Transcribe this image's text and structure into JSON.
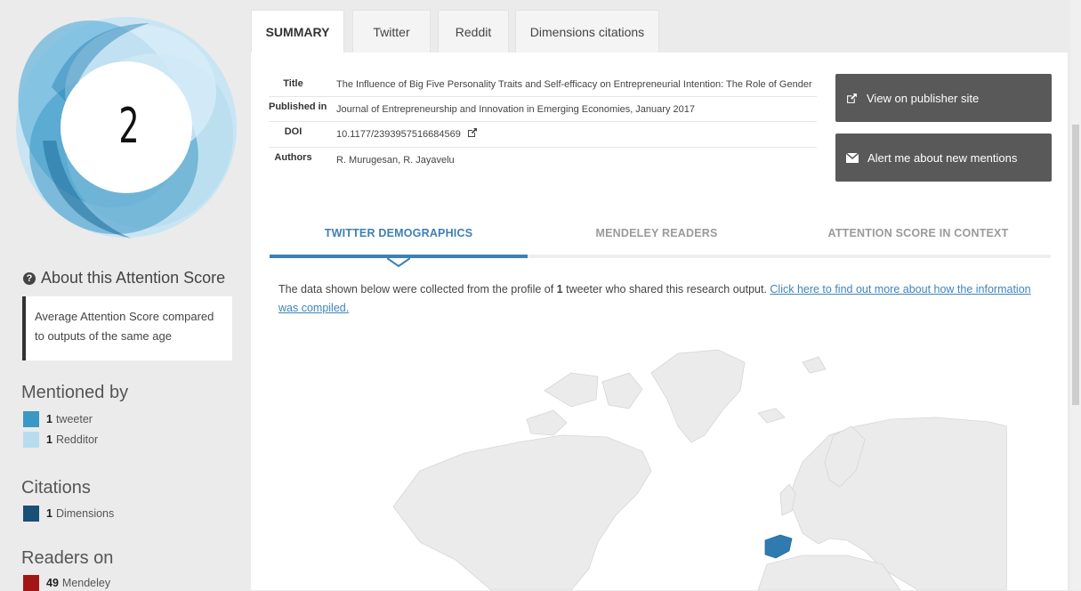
{
  "score": {
    "value": "2"
  },
  "about": {
    "heading": "About this Attention Score",
    "description": "Average Attention Score compared to outputs of the same age"
  },
  "mentioned_by": {
    "heading": "Mentioned by",
    "items": [
      {
        "count": "1",
        "label": "tweeter",
        "color": "#3a98c4"
      },
      {
        "count": "1",
        "label": "Redditor",
        "color": "#b8dcef"
      }
    ]
  },
  "citations": {
    "heading": "Citations",
    "items": [
      {
        "count": "1",
        "label": "Dimensions",
        "color": "#1a4f78"
      }
    ]
  },
  "readers": {
    "heading": "Readers on",
    "items": [
      {
        "count": "49",
        "label": "Mendeley",
        "color": "#a31616"
      }
    ]
  },
  "tabs": [
    {
      "label": "SUMMARY",
      "active": true
    },
    {
      "label": "Twitter",
      "active": false
    },
    {
      "label": "Reddit",
      "active": false
    },
    {
      "label": "Dimensions citations",
      "active": false
    }
  ],
  "metadata": {
    "title_label": "Title",
    "title_value": "The Influence of Big Five Personality Traits and Self-efficacy on Entrepreneurial Intention: The Role of Gender",
    "published_label": "Published in",
    "published_value": "Journal of Entrepreneurship and Innovation in Emerging Economies, January 2017",
    "doi_label": "DOI",
    "doi_value": "10.1177/2393957516684569",
    "authors_label": "Authors",
    "authors_value": "R. Murugesan, R. Jayavelu"
  },
  "buttons": {
    "publisher": "View on publisher site",
    "alert": "Alert me about new mentions"
  },
  "secondary_tabs": [
    {
      "label": "TWITTER DEMOGRAPHICS",
      "active": true
    },
    {
      "label": "MENDELEY READERS",
      "active": false
    },
    {
      "label": "ATTENTION SCORE IN CONTEXT",
      "active": false
    }
  ],
  "description": {
    "pre": "The data shown below were collected from the profile of ",
    "count": "1",
    "post": " tweeter who shared this research output. ",
    "link": "Click here to find out more about how the information was compiled."
  },
  "colors": {
    "accent": "#3e7fb5",
    "donut_light": "#b8dcef",
    "donut_mid": "#3a98c4",
    "button_bg": "#595959",
    "map_land": "#e8e8e8",
    "map_highlight": "#2f7bb0"
  }
}
